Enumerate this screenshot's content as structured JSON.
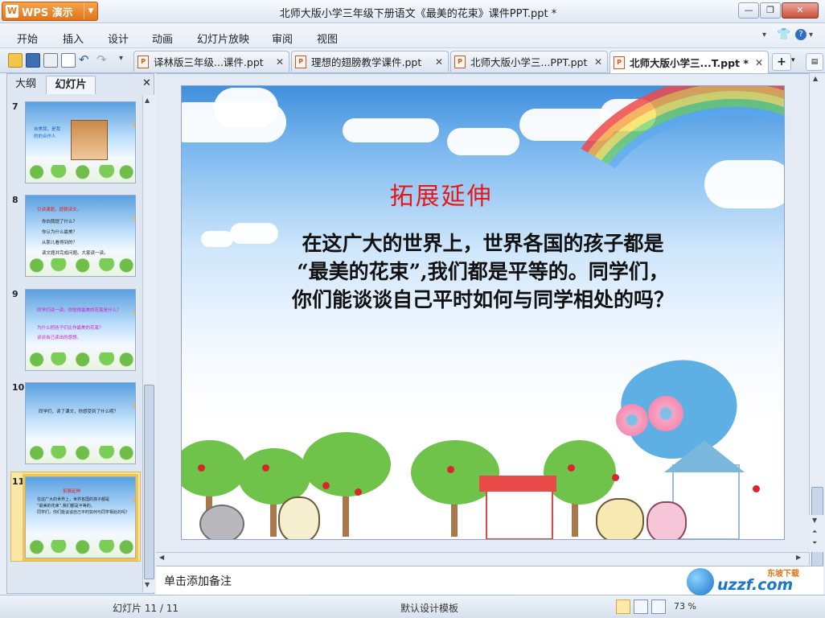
{
  "app": {
    "name": "WPS 演示",
    "document_title": "北师大版小学三年级下册语文《最美的花束》课件PPT.ppt *"
  },
  "menu": [
    "开始",
    "插入",
    "设计",
    "动画",
    "幻灯片放映",
    "审阅",
    "视图"
  ],
  "tabs": [
    {
      "label": "译林版三年级...课件.ppt",
      "active": false
    },
    {
      "label": "理想的翅膀教学课件.ppt",
      "active": false
    },
    {
      "label": "北师大版小学三...PPT.ppt",
      "active": false
    },
    {
      "label": "北师大版小学三...T.ppt *",
      "active": true
    }
  ],
  "left_panel": {
    "tabs": [
      "大纲",
      "幻灯片"
    ],
    "active_tab": "幻灯片",
    "thumbnails": [
      {
        "number": "7",
        "lines": [
          "自美我，是我",
          "的的合作人"
        ]
      },
      {
        "number": "8",
        "lines": [
          "引读课题，提朝读文。",
          "你向我提了什么？",
          "你认为什么最美？",
          "从那儿看得到的？",
          "读文题并完成问题。大家读一读。"
        ]
      },
      {
        "number": "9",
        "lines": [
          "同学们读一读。你觉得最美的花束是什么？",
          "为什么把孩子们比作最美的花束？",
          "谈谈自己读出的感想。"
        ]
      },
      {
        "number": "10",
        "lines": [
          "同学们，读了课文，你感受到了什么呢？"
        ]
      },
      {
        "number": "11",
        "lines": [
          "拓展延伸",
          "在这广大的世界上，世界各国的孩子都是",
          "“最美的花束”,我们都是平等的。",
          "同学们，你们能谈谈自己平时如何与同学相处的吗？"
        ]
      }
    ],
    "selected_index": 4
  },
  "slide": {
    "title": "拓展延伸",
    "lines": [
      "在这广大的世界上，世界各国的孩子都是",
      "“最美的花束”,我们都是平等的。同学们，",
      "你们能谈谈自己平时如何与同学相处的吗？"
    ]
  },
  "notes_placeholder": "单击添加备注",
  "status": {
    "slide_position": "幻灯片 11 / 11",
    "theme": "默认设计模板",
    "zoom": "73 %"
  },
  "watermark": {
    "text": "uzzf.com",
    "subtext": "东坡下载"
  },
  "colors": {
    "accent_orange": "#e0751a",
    "title_red": "#e41818",
    "selection_yellow": "#f4c44b"
  }
}
